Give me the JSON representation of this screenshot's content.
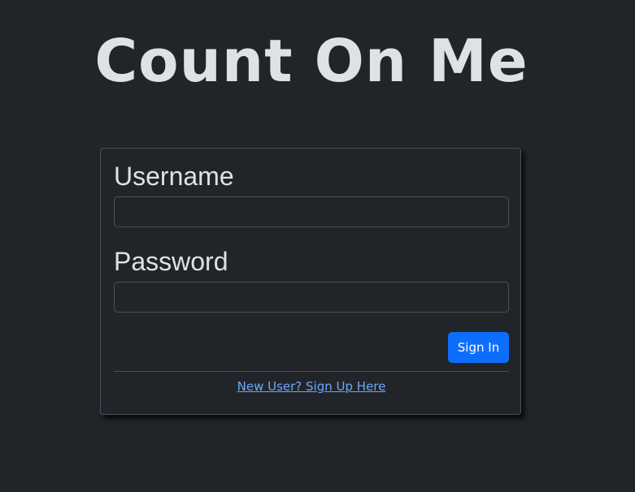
{
  "app": {
    "title": "Count On Me"
  },
  "login_form": {
    "username_label": "Username",
    "username_value": "",
    "password_label": "Password",
    "password_value": "",
    "signin_label": "Sign In",
    "signup_link_label": "New User? Sign Up Here"
  },
  "colors": {
    "background": "#212529",
    "text": "#dee2e6",
    "border": "#495057",
    "primary_button": "#0d6efd",
    "link": "#6ea8fe"
  }
}
